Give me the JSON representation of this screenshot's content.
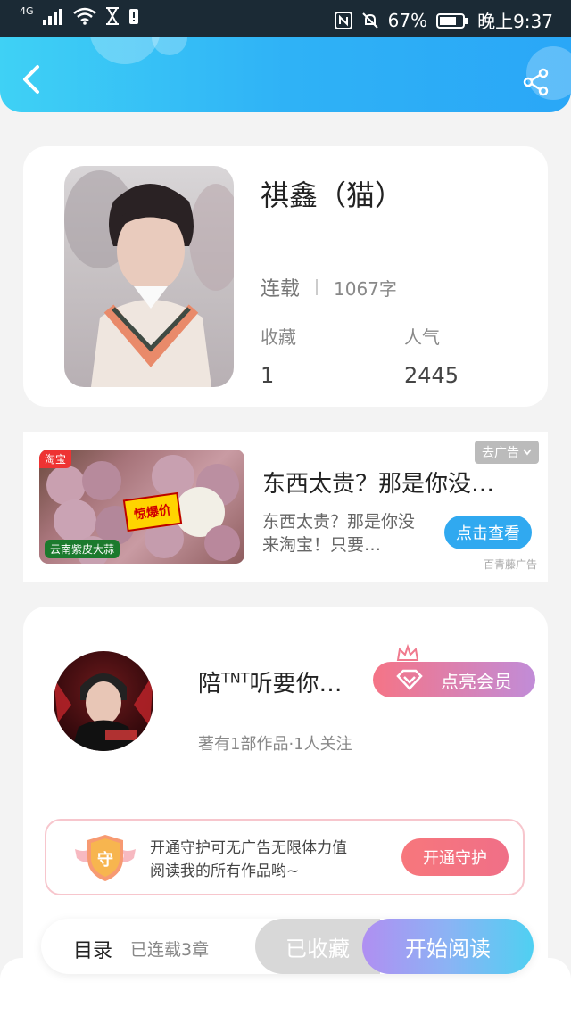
{
  "status_bar": {
    "network": "4G",
    "battery_percent": "67%",
    "time": "晚上9:37"
  },
  "header": {
    "back_icon": "chevron-left-icon",
    "share_icon": "share-icon"
  },
  "book": {
    "title": "祺鑫（猫）",
    "status": "连载",
    "word_count": "1067字",
    "favorites_label": "收藏",
    "favorites_value": "1",
    "popularity_label": "人气",
    "popularity_value": "2445"
  },
  "ad": {
    "close_label": "去广告",
    "title": "东西太贵？那是你没…",
    "description": "东西太贵？那是你没来淘宝！只要…",
    "cta": "点击查看",
    "source": "百青藤广告",
    "image_tag": "淘宝",
    "image_burst": "惊爆价",
    "image_caption": "云南紫皮大蒜"
  },
  "author": {
    "name_prefix": "陪",
    "name_sup": "TNT",
    "name_suffix": "听要你…",
    "meta": "著有1部作品·1人关注",
    "vip_label": "点亮会员",
    "guard_text_line1": "开通守护可无广告无限体力值",
    "guard_text_line2": "阅读我的所有作品哟~",
    "guard_button": "开通守护",
    "guard_badge": "守"
  },
  "bottom_bar": {
    "toc_label": "目录",
    "chapters": "已连载3章",
    "collected_label": "已收藏",
    "read_label": "开始阅读"
  },
  "colors": {
    "header_gradient_start": "#3fd1f5",
    "header_gradient_end": "#2aa7f7",
    "ad_button": "#30a9f0",
    "vip_gradient_start": "#f57486",
    "vip_gradient_end": "#c18cd8",
    "guard_button": "#f7777c"
  }
}
